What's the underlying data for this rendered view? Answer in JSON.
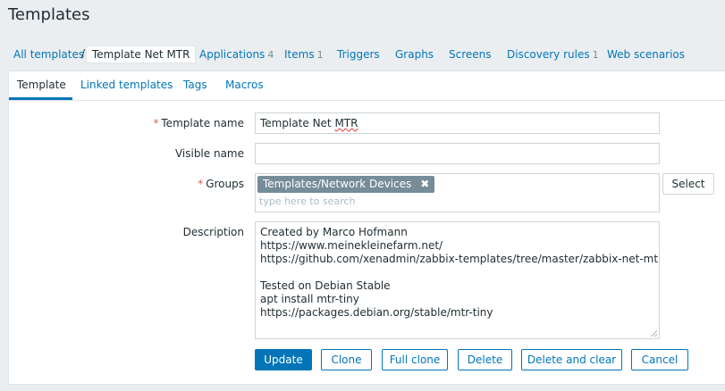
{
  "page": {
    "title": "Templates"
  },
  "nav": {
    "all_templates": "All templates",
    "separator": "/",
    "current": "Template Net MTR",
    "links": [
      {
        "label": "Applications",
        "count": "4"
      },
      {
        "label": "Items",
        "count": "1"
      },
      {
        "label": "Triggers",
        "count": ""
      },
      {
        "label": "Graphs",
        "count": ""
      },
      {
        "label": "Screens",
        "count": ""
      },
      {
        "label": "Discovery rules",
        "count": "1"
      },
      {
        "label": "Web scenarios",
        "count": ""
      }
    ]
  },
  "tabs": [
    {
      "label": "Template",
      "active": true
    },
    {
      "label": "Linked templates",
      "active": false
    },
    {
      "label": "Tags",
      "active": false
    },
    {
      "label": "Macros",
      "active": false
    }
  ],
  "form": {
    "required_mark": "*",
    "template_name": {
      "label": "Template name",
      "value": "Template Net MTR",
      "value_prefix": "Template Net ",
      "value_suffix": "MTR"
    },
    "visible_name": {
      "label": "Visible name",
      "value": ""
    },
    "groups": {
      "label": "Groups",
      "selected": [
        "Templates/Network Devices"
      ],
      "remove_icon": "close-icon",
      "placeholder": "type here to search",
      "select_label": "Select"
    },
    "description": {
      "label": "Description",
      "value": "Created by Marco Hofmann\nhttps://www.meinekleinefarm.net/\nhttps://github.com/xenadmin/zabbix-templates/tree/master/zabbix-net-mtr\n\nTested on Debian Stable\napt install mtr-tiny\nhttps://packages.debian.org/stable/mtr-tiny"
    }
  },
  "buttons": {
    "update": "Update",
    "clone": "Clone",
    "full_clone": "Full clone",
    "delete": "Delete",
    "delete_and_clear": "Delete and clear",
    "cancel": "Cancel"
  },
  "colors": {
    "accent": "#0275b8",
    "required": "#e45959",
    "chip": "#768d99"
  }
}
